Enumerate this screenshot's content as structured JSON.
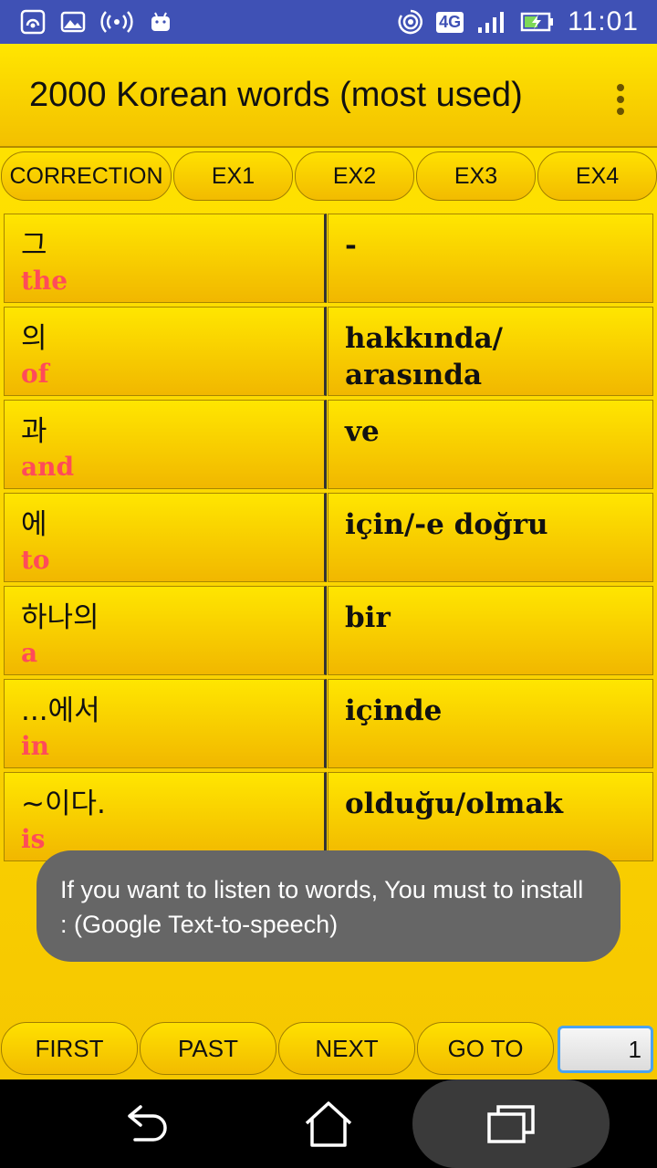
{
  "status_bar": {
    "time": "11:01",
    "network": "4G",
    "icons": [
      "wifi-hotspot-icon",
      "image-notification-icon",
      "broadcast-icon",
      "android-icon",
      "cast-icon",
      "network-4g-icon",
      "signal-icon",
      "battery-charging-icon"
    ]
  },
  "app_bar": {
    "title": "2000 Korean words (most used)",
    "overflow_icon": "more-vert-icon"
  },
  "tabs": [
    {
      "label": "CORRECTION"
    },
    {
      "label": "EX1"
    },
    {
      "label": "EX2"
    },
    {
      "label": "EX3"
    },
    {
      "label": "EX4"
    }
  ],
  "words": [
    {
      "korean": "그",
      "english": "the",
      "translation": "-"
    },
    {
      "korean": "의",
      "english": "of",
      "translation": "hakkında/ arasında"
    },
    {
      "korean": "과",
      "english": "and",
      "translation": "ve"
    },
    {
      "korean": "에",
      "english": "to",
      "translation": "için/-e doğru"
    },
    {
      "korean": "하나의",
      "english": "a",
      "translation": "bir"
    },
    {
      "korean": "...에서",
      "english": "in",
      "translation": "içinde"
    },
    {
      "korean": "~이다.",
      "english": "is",
      "translation": "olduğu/olmak"
    }
  ],
  "toast": {
    "message": "If you want to listen to words, You must to install : (Google Text-to-speech)"
  },
  "bottom_bar": {
    "first_label": "FIRST",
    "past_label": "PAST",
    "next_label": "NEXT",
    "goto_label": "GO TO",
    "page_value": "1"
  },
  "nav_bar": {
    "icons": [
      "back-icon",
      "home-icon",
      "recent-apps-icon"
    ]
  },
  "colors": {
    "status_bar": "#3f51b5",
    "app_yellow": "#ffe400",
    "english_word": "#ff4b59",
    "toast_bg": "#666666",
    "page_box_border": "#4aa3f0"
  }
}
